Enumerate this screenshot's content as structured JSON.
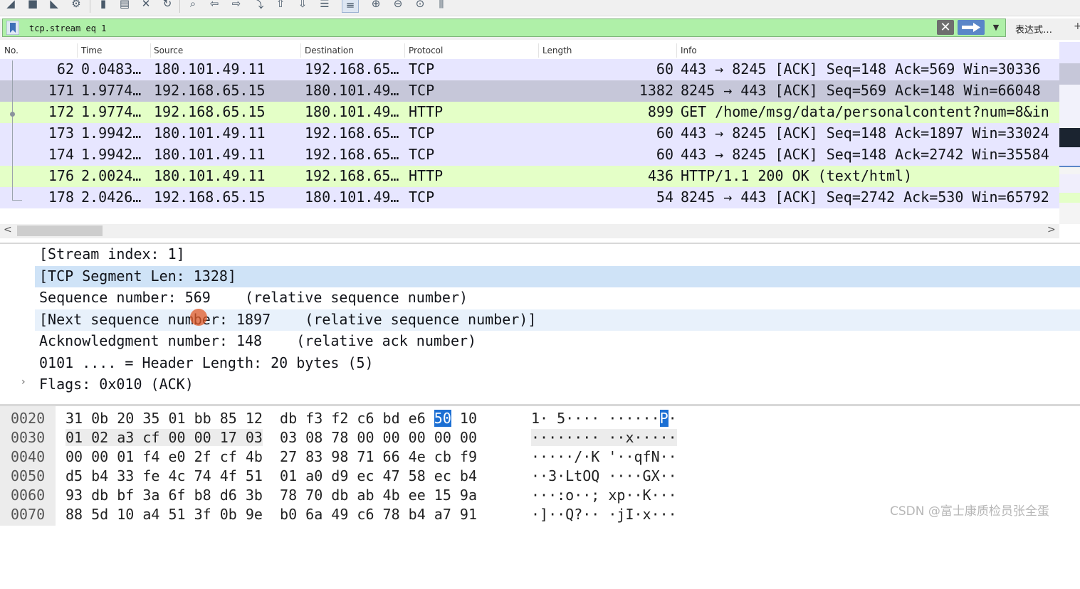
{
  "filter": {
    "value": "tcp.stream eq 1",
    "expression_button": "表达式…",
    "plus": "+"
  },
  "packet_list": {
    "columns": [
      "No.",
      "Time",
      "Source",
      "Destination",
      "Protocol",
      "Length",
      "Info"
    ],
    "rows": [
      {
        "no": "62",
        "time": "0.0483…",
        "src": "180.101.49.11",
        "dst": "192.168.65…",
        "proto": "TCP",
        "len": "60",
        "info": "443 → 8245 [ACK] Seq=148 Ack=569 Win=30336",
        "bg": "#e7e6ff"
      },
      {
        "no": "171",
        "time": "1.9774…",
        "src": "192.168.65.15",
        "dst": "180.101.49…",
        "proto": "TCP",
        "len": "1382",
        "info": "8245 → 443 [ACK] Seq=569 Ack=148 Win=66048",
        "bg": "#c6c7d9"
      },
      {
        "no": "172",
        "time": "1.9774…",
        "src": "192.168.65.15",
        "dst": "180.101.49…",
        "proto": "HTTP",
        "len": "899",
        "info": "GET /home/msg/data/personalcontent?num=8&in",
        "bg": "#e4ffc7"
      },
      {
        "no": "173",
        "time": "1.9942…",
        "src": "180.101.49.11",
        "dst": "192.168.65…",
        "proto": "TCP",
        "len": "60",
        "info": "443 → 8245 [ACK] Seq=148 Ack=1897 Win=33024",
        "bg": "#e7e6ff"
      },
      {
        "no": "174",
        "time": "1.9942…",
        "src": "180.101.49.11",
        "dst": "192.168.65…",
        "proto": "TCP",
        "len": "60",
        "info": "443 → 8245 [ACK] Seq=148 Ack=2742 Win=35584",
        "bg": "#e7e6ff"
      },
      {
        "no": "176",
        "time": "2.0024…",
        "src": "180.101.49.11",
        "dst": "192.168.65…",
        "proto": "HTTP",
        "len": "436",
        "info": "HTTP/1.1 200 OK  (text/html)",
        "bg": "#e4ffc7"
      },
      {
        "no": "178",
        "time": "2.0426…",
        "src": "192.168.65.15",
        "dst": "180.101.49…",
        "proto": "TCP",
        "len": "54",
        "info": "8245 → 443 [ACK] Seq=2742 Ack=530 Win=65792",
        "bg": "#e7e6ff"
      }
    ],
    "scroll_left": "<",
    "scroll_right": ">"
  },
  "details": {
    "rows": [
      "[Stream index: 1]",
      "[TCP Segment Len: 1328]",
      "Sequence number: 569    (relative sequence number)",
      "[Next sequence number: 1897    (relative sequence number)]",
      "Acknowledgment number: 148    (relative ack number)",
      "0101 .... = Header Length: 20 bytes (5)",
      "Flags: 0x010 (ACK)"
    ],
    "flags_expander": "›"
  },
  "hex": {
    "lines": [
      {
        "off": "0020",
        "b1": "31 0b 20 35 01 bb 85 12",
        "b2a": "db f3 f2 c6 bd e6 ",
        "hl": "50",
        "b2b": " 10",
        "a1": "1· 5···· ······",
        "ahl": "P",
        "a2": "·"
      },
      {
        "off": "0030",
        "b1": "01 02 a3 cf 00 00 17 03",
        "b2a": "03 08 78 00 00 00 00 00",
        "hl": "",
        "b2b": "",
        "a1": "········ ··x·····",
        "ahl": "",
        "a2": ""
      },
      {
        "off": "0040",
        "b1": "00 00 01 f4 e0 2f cf 4b",
        "b2a": "27 83 98 71 66 4e cb f9",
        "hl": "",
        "b2b": "",
        "a1": "·····/·K '··qfN··",
        "ahl": "",
        "a2": ""
      },
      {
        "off": "0050",
        "b1": "d5 b4 33 fe 4c 74 4f 51",
        "b2a": "01 a0 d9 ec 47 58 ec b4",
        "hl": "",
        "b2b": "",
        "a1": "··3·LtOQ ····GX··",
        "ahl": "",
        "a2": ""
      },
      {
        "off": "0060",
        "b1": "93 db bf 3a 6f b8 d6 3b",
        "b2a": "78 70 db ab 4b ee 15 9a",
        "hl": "",
        "b2b": "",
        "a1": "···:o··; xp··K···",
        "ahl": "",
        "a2": ""
      },
      {
        "off": "0070",
        "b1": "88 5d 10 a4 51 3f 0b 9e",
        "b2a": "b0 6a 49 c6 78 b4 a7 91",
        "hl": "",
        "b2b": "",
        "a1": "·]··Q?·· ·jI·x···",
        "ahl": "",
        "a2": ""
      }
    ]
  },
  "watermark": "CSDN @富士康质检员张全蛋",
  "colors": {
    "filter_bg": "#aff0a8",
    "tcp_row": "#e7e6ff",
    "http_row": "#e4ffc7",
    "selected_row": "#c6c7d9",
    "hex_highlight": "#1c6fd3"
  }
}
